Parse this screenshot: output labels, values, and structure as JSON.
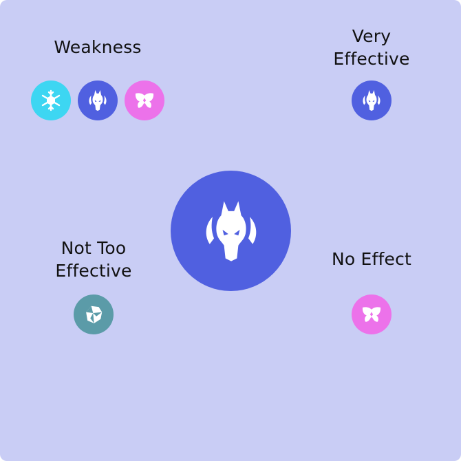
{
  "colors": {
    "card_background": "#c9cdf5",
    "dragon": "#5060e0",
    "ice": "#3dd6f2",
    "fairy": "#ec72ea",
    "rock": "#5b9ba8"
  },
  "main_type": {
    "icon": "dragon-icon",
    "color": "#5060e0"
  },
  "sections": {
    "weakness": {
      "title": "Weakness",
      "types": [
        {
          "icon": "ice-icon",
          "color": "#3dd6f2"
        },
        {
          "icon": "dragon-icon",
          "color": "#5060e0"
        },
        {
          "icon": "fairy-icon",
          "color": "#ec72ea"
        }
      ]
    },
    "very_effective": {
      "title": "Very\nEffective",
      "types": [
        {
          "icon": "dragon-icon",
          "color": "#5060e0"
        }
      ]
    },
    "not_too_effective": {
      "title": "Not Too\nEffective",
      "types": [
        {
          "icon": "rock-icon",
          "color": "#5b9ba8"
        }
      ]
    },
    "no_effect": {
      "title": "No Effect",
      "types": [
        {
          "icon": "fairy-icon",
          "color": "#ec72ea"
        }
      ]
    }
  }
}
